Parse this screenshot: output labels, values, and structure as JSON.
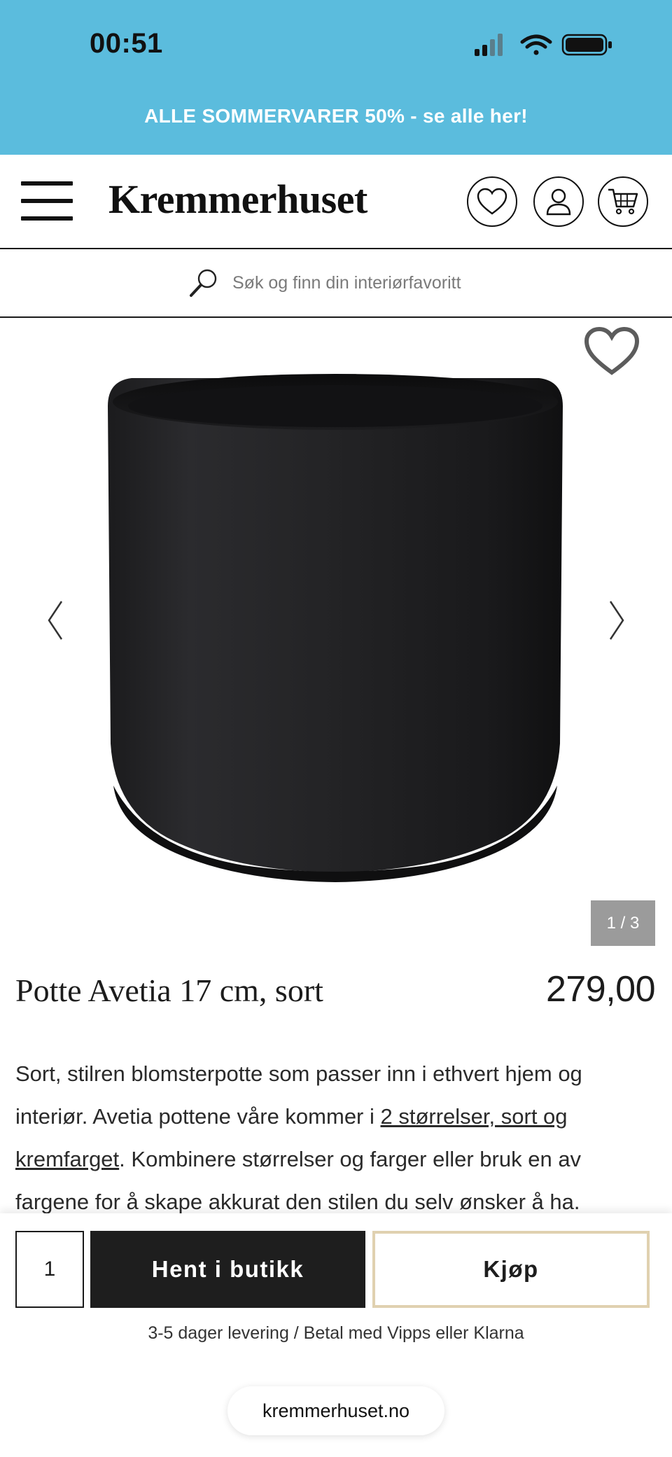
{
  "status_bar": {
    "time": "00:51",
    "icons": [
      "signal-icon",
      "wifi-icon",
      "battery-icon"
    ]
  },
  "promo_banner": {
    "text": "ALLE SOMMERVARER 50% - se alle her!",
    "background": "#5bbcdd"
  },
  "header": {
    "logo": "Kremmerhuset",
    "icons": [
      "menu-icon",
      "heart-icon",
      "user-icon",
      "cart-icon"
    ]
  },
  "search": {
    "placeholder": "Søk og finn din interiørfavoritt"
  },
  "gallery": {
    "counter": "1 / 3",
    "icons": [
      "favorite-heart-icon",
      "chevron-left-icon",
      "chevron-right-icon"
    ]
  },
  "product": {
    "title": "Potte Avetia 17 cm, sort",
    "price": "279,00",
    "description_part1": "Sort, stilren blomsterpotte som passer inn i ethvert hjem og interiør. Avetia pottene våre kommer i ",
    "description_link": "2 størrelser, sort og kremfarget",
    "description_part2": ". Kombinere størrelser og farger eller bruk en av fargene for å skape akkurat den stilen du selv ønsker å ha."
  },
  "purchase": {
    "quantity": "1",
    "store_pickup_label": "Hent i butikk",
    "buy_label": "Kjøp",
    "delivery_info": "3-5 dager levering / Betal med Vipps eller Klarna",
    "accent_border": "#e0d1b0"
  },
  "browser": {
    "domain": "kremmerhuset.no"
  }
}
